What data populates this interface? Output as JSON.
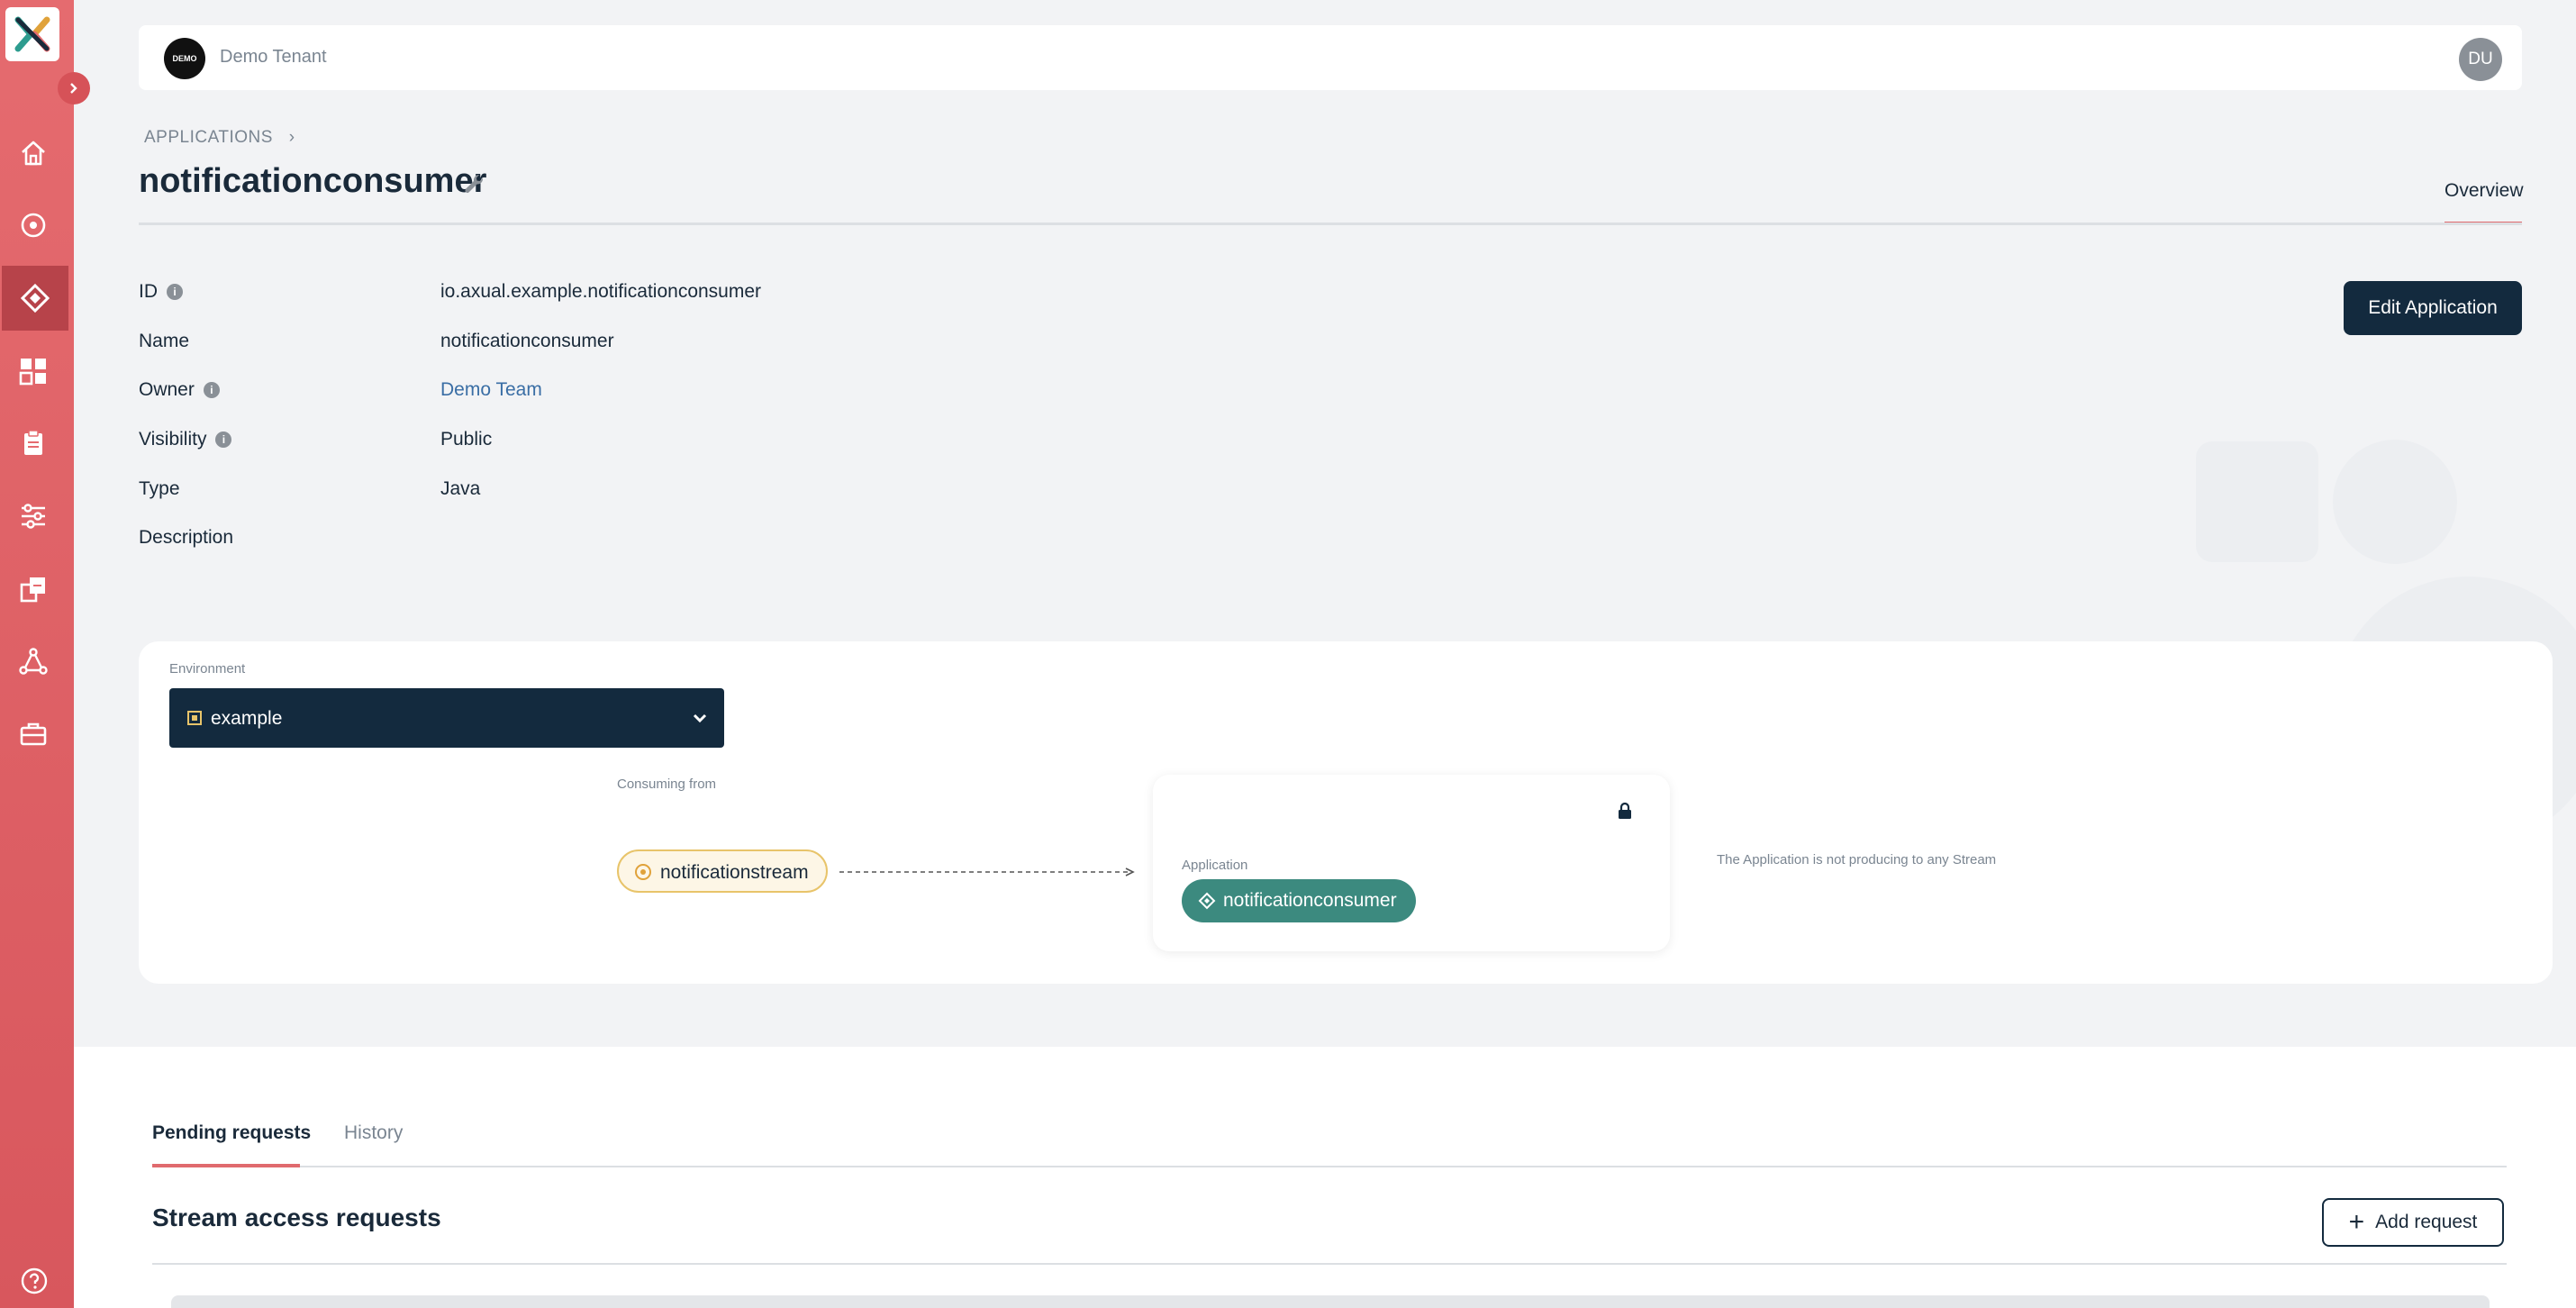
{
  "tenant": {
    "logo_text": "DEMO",
    "name": "Demo Tenant"
  },
  "user": {
    "initials": "DU"
  },
  "breadcrumb": {
    "root": "APPLICATIONS"
  },
  "page": {
    "title": "notificationconsumer",
    "tab": "Overview"
  },
  "details": {
    "id_label": "ID",
    "id_value": "io.axual.example.notificationconsumer",
    "name_label": "Name",
    "name_value": "notificationconsumer",
    "owner_label": "Owner",
    "owner_value": "Demo Team",
    "visibility_label": "Visibility",
    "visibility_value": "Public",
    "type_label": "Type",
    "type_value": "Java",
    "description_label": "Description"
  },
  "actions": {
    "edit": "Edit Application",
    "add_request": "Add request"
  },
  "environment": {
    "label": "Environment",
    "selected": "example",
    "consuming_label": "Consuming from",
    "stream": "notificationstream",
    "app_label": "Application",
    "app_name": "notificationconsumer",
    "producing_note": "The Application is not producing to any Stream"
  },
  "requests": {
    "tabs": [
      "Pending requests",
      "History"
    ],
    "section_title": "Stream access requests"
  },
  "colors": {
    "sidebar": "#e56b6f",
    "primary": "#132a3e",
    "accent": "#e06a6e",
    "app_chip": "#3c8a7f",
    "stream_border": "#e8c46a"
  },
  "icons": {
    "sidebar": [
      "home-icon",
      "streams-icon",
      "applications-icon",
      "dashboard-icon",
      "clipboard-icon",
      "settings-sliders-icon",
      "copy-icon",
      "network-icon",
      "toolbox-icon",
      "help-icon"
    ]
  }
}
